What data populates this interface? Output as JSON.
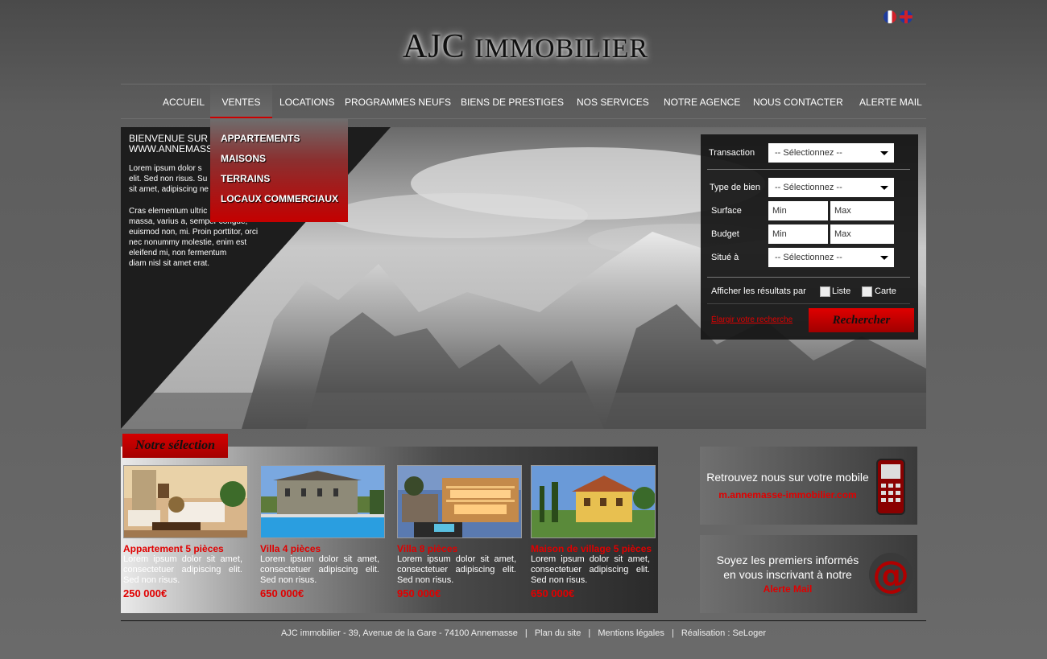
{
  "header": {
    "logo_main": "AJC",
    "logo_rest": "Immobilier",
    "flags": [
      "french-flag-icon",
      "english-flag-icon"
    ]
  },
  "nav": {
    "items": [
      "ACCUEIL",
      "VENTES",
      "LOCATIONS",
      "PROGRAMMES NEUFS",
      "BIENS DE PRESTIGES",
      "NOS SERVICES",
      "NOTRE AGENCE",
      "NOUS CONTACTER",
      "ALERTE MAIL"
    ],
    "active": "VENTES",
    "dropdown": [
      "APPARTEMENTS",
      "MAISONS",
      "TERRAINS",
      "LOCAUX COMMERCIAUX"
    ]
  },
  "intro": {
    "heading_line1": "BIENVENUE SUR",
    "heading_line2": "WWW.ANNEMASS",
    "para1": [
      "Lorem ipsum dolor s",
      "elit. Sed non risus. Su",
      "sit amet, adipiscing ne"
    ],
    "para2": [
      "Cras elementum ultric",
      "massa, varius a, semper congue,",
      "euismod non, mi. Proin porttitor, orci",
      "nec nonummy molestie, enim est",
      "eleifend mi, non fermentum",
      "diam nisl sit amet erat."
    ]
  },
  "search": {
    "transaction_label": "Transaction",
    "transaction_value": "-- Sélectionnez --",
    "type_label": "Type de bien",
    "type_value": "-- Sélectionnez --",
    "surface_label": "Surface",
    "surface_min": "Min",
    "surface_max": "Max",
    "budget_label": "Budget",
    "budget_min": "Min",
    "budget_max": "Max",
    "situe_label": "Situé à",
    "situe_value": "-- Sélectionnez --",
    "results_label": "Afficher les résultats par",
    "opt_liste": "Liste",
    "opt_carte": "Carte",
    "elargir": "Élargir votre recherche",
    "button": "Rechercher"
  },
  "selection": {
    "tab": "Notre sélection",
    "cards": [
      {
        "title": "Appartement 5 pièces",
        "desc": "Lorem ipsum dolor sit amet, consectetuer adipiscing elit. Sed non risus.",
        "price": "250 000€"
      },
      {
        "title": "Villa 4 pièces",
        "desc": "Lorem ipsum dolor sit amet, consectetuer adipiscing elit. Sed non risus.",
        "price": "650 000€"
      },
      {
        "title": "Villa 8 pièces",
        "desc": "Lorem ipsum dolor sit amet, consectetuer adipiscing elit. Sed non risus.",
        "price": "950 000€"
      },
      {
        "title": "Maison de village 5 pièces",
        "desc": "Lorem ipsum dolor sit amet, consectetuer adipiscing elit. Sed non risus.",
        "price": "650 000€"
      }
    ]
  },
  "promos": {
    "mobile_text": "Retrouvez nous sur votre mobile",
    "mobile_link": "m.annemasse-immobilier.com",
    "alert_line1": "Soyez les premiers informés",
    "alert_line2": "en vous inscrivant à notre",
    "alert_link": "Alerte Mail"
  },
  "footer": {
    "address": "AJC immobilier - 39, Avenue de la Gare - 74100 Annemasse",
    "plan": "Plan du site",
    "mentions": "Mentions légales",
    "realisation": "Réalisation : SeLoger"
  }
}
